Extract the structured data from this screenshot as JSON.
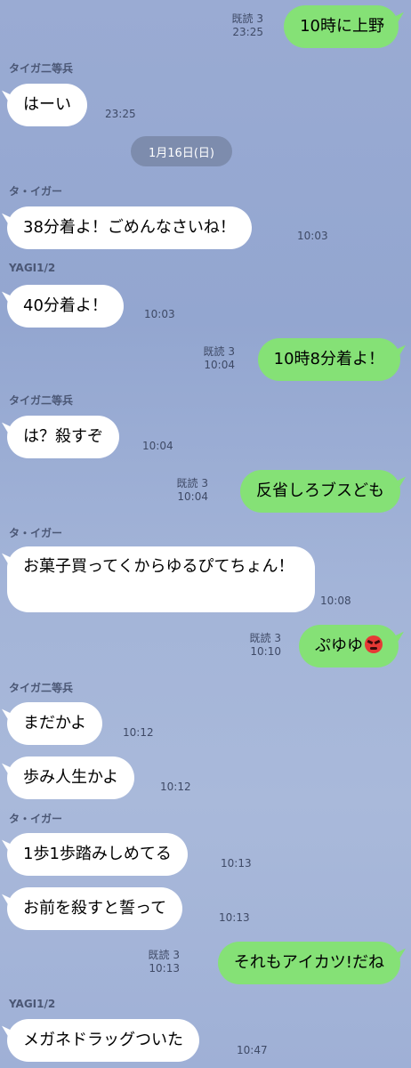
{
  "date_separator": "1月16日(日)",
  "messages": [
    {
      "side": "me",
      "text": "10時に上野",
      "read": "既読 3",
      "time": "23:25"
    },
    {
      "side": "other",
      "sender": "タイガ二等兵",
      "text": "はーい",
      "time": "23:25"
    },
    {
      "side": "other",
      "sender": "タ・イガー",
      "text": "38分着よ！ごめんなさいね！",
      "time": "10:03"
    },
    {
      "side": "other",
      "sender": "YAGI1/2",
      "text": "40分着よ！",
      "time": "10:03"
    },
    {
      "side": "me",
      "text": "10時8分着よ！",
      "read": "既読 3",
      "time": "10:04"
    },
    {
      "side": "other",
      "sender": "タイガ二等兵",
      "text": "は？殺すぞ",
      "time": "10:04"
    },
    {
      "side": "me",
      "text": "反省しろブスども",
      "read": "既読 3",
      "time": "10:04"
    },
    {
      "side": "other",
      "sender": "タ・イガー",
      "text": "お菓子買ってくからゆるぴてちょん！",
      "time": "10:08"
    },
    {
      "side": "me",
      "text": "ぷゆゆ",
      "emoji": "angry-face-emoji",
      "read": "既読 3",
      "time": "10:10"
    },
    {
      "side": "other",
      "sender": "タイガ二等兵",
      "text": "まだかよ",
      "time": "10:12"
    },
    {
      "side": "other",
      "text": "歩み人生かよ",
      "time": "10:12"
    },
    {
      "side": "other",
      "sender": "タ・イガー",
      "text": "1歩1歩踏みしめてる",
      "time": "10:13"
    },
    {
      "side": "other",
      "text": "お前を殺すと誓って",
      "time": "10:13"
    },
    {
      "side": "me",
      "text": "それもアイカツ!だね",
      "read": "既読 3",
      "time": "10:13"
    },
    {
      "side": "other",
      "sender": "YAGI1/2",
      "text": "メガネドラッグついた",
      "time": "10:47"
    }
  ],
  "colors": {
    "background": "#9aabd3",
    "my_bubble": "#85e176",
    "their_bubble": "#ffffff",
    "date_pill": "#7d8cad"
  }
}
